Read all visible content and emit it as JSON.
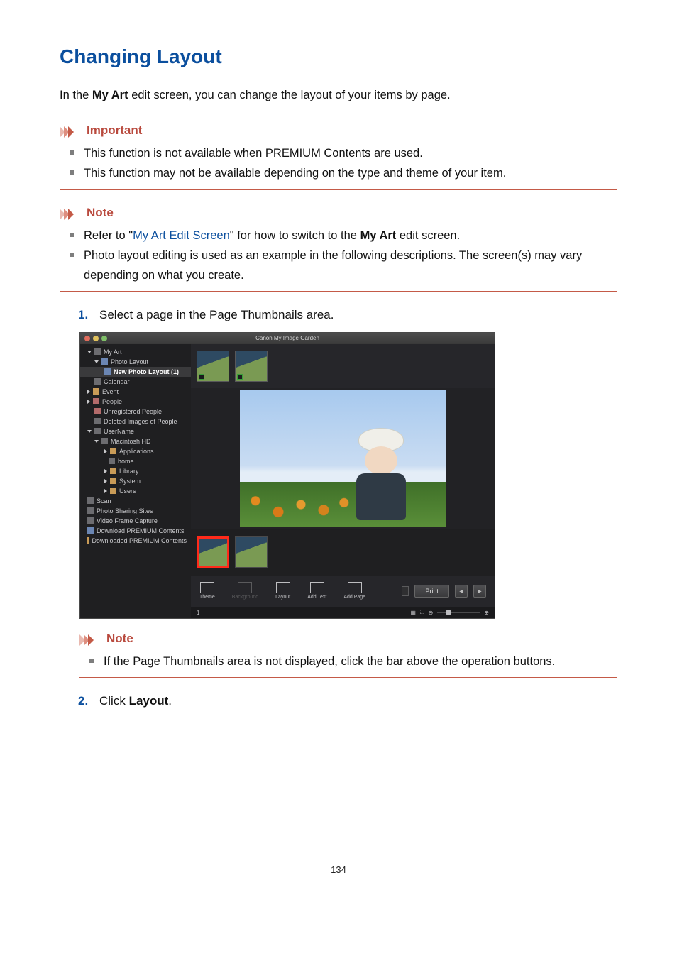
{
  "page_number": "134",
  "heading": "Changing Layout",
  "intro": {
    "pre": "In the ",
    "bold": "My Art",
    "post": " edit screen, you can change the layout of your items by page."
  },
  "important": {
    "label": "Important",
    "items": [
      "This function is not available when PREMIUM Contents are used.",
      "This function may not be available depending on the type and theme of your item."
    ]
  },
  "note1": {
    "label": "Note",
    "items": [
      {
        "pre": "Refer to \"",
        "link": "My Art Edit Screen",
        "mid": "\" for how to switch to the ",
        "bold": "My Art",
        "post": " edit screen."
      },
      {
        "text": "Photo layout editing is used as an example in the following descriptions. The screen(s) may vary depending on what you create."
      }
    ]
  },
  "steps": [
    {
      "num": "1.",
      "text": "Select a page in the Page Thumbnails area."
    },
    {
      "num": "2.",
      "pre": "Click ",
      "bold": "Layout",
      "post": "."
    }
  ],
  "note2": {
    "label": "Note",
    "items": [
      "If the Page Thumbnails area is not displayed, click the bar above the operation buttons."
    ]
  },
  "shot": {
    "window_title": "Canon My Image Garden",
    "sidebar": [
      "My Art",
      "Photo Layout",
      "New Photo Layout (1)",
      "Calendar",
      "Event",
      "People",
      "Unregistered People",
      "Deleted Images of People",
      "UserName",
      "Macintosh HD",
      "Applications",
      "home",
      "Library",
      "System",
      "Users",
      "Scan",
      "Photo Sharing Sites",
      "Video Frame Capture",
      "Download PREMIUM Contents",
      "Downloaded PREMIUM Contents"
    ],
    "toolbar": {
      "theme": "Theme",
      "background": "Background",
      "layout": "Layout",
      "add_text": "Add Text",
      "add_page": "Add Page",
      "print": "Print"
    },
    "status_left": "1"
  }
}
